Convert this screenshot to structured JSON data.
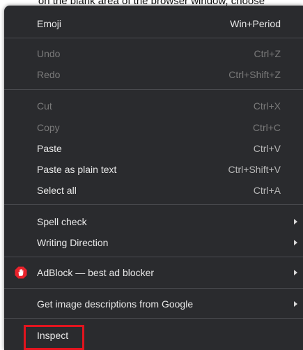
{
  "caption": "on the blank area of the browser window, choose",
  "menu": {
    "emoji": {
      "label": "Emoji",
      "shortcut": "Win+Period"
    },
    "undo": {
      "label": "Undo",
      "shortcut": "Ctrl+Z"
    },
    "redo": {
      "label": "Redo",
      "shortcut": "Ctrl+Shift+Z"
    },
    "cut": {
      "label": "Cut",
      "shortcut": "Ctrl+X"
    },
    "copy": {
      "label": "Copy",
      "shortcut": "Ctrl+C"
    },
    "paste": {
      "label": "Paste",
      "shortcut": "Ctrl+V"
    },
    "paste_plain": {
      "label": "Paste as plain text",
      "shortcut": "Ctrl+Shift+V"
    },
    "select_all": {
      "label": "Select all",
      "shortcut": "Ctrl+A"
    },
    "spell_check": {
      "label": "Spell check"
    },
    "writing_direction": {
      "label": "Writing Direction"
    },
    "adblock": {
      "label": "AdBlock — best ad blocker",
      "icon": "adblock-hand-icon"
    },
    "image_descriptions": {
      "label": "Get image descriptions from Google"
    },
    "inspect": {
      "label": "Inspect"
    }
  },
  "colors": {
    "menu_bg": "#2a2b2e",
    "highlight": "#e2141e",
    "adblock_red": "#e8222b"
  }
}
